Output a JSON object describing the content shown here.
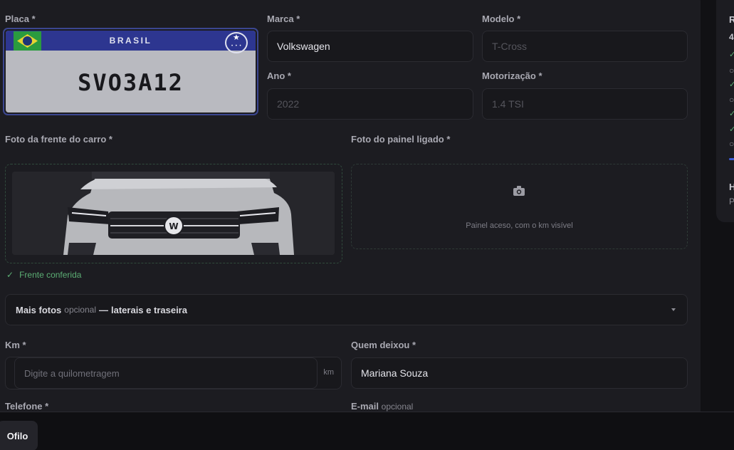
{
  "form": {
    "placa_label": "Placa *",
    "marca_label": "Marca *",
    "marca_value": "Volkswagen",
    "modelo_label": "Modelo *",
    "modelo_value": "T-Cross",
    "ano_label": "Ano *",
    "ano_value": "2022",
    "motor_label": "Motorização *",
    "motor_value": "1.4 TSI",
    "plate": {
      "country": "BRASIL",
      "number": "SVO3A12"
    },
    "foto_frente_label": "Foto da frente do carro *",
    "foto_painel_label": "Foto do painel ligado *",
    "painel_hint": "Painel aceso, com o km visível",
    "frente_status": "Frente conferida",
    "mais_fotos": {
      "title": "Mais fotos",
      "optional": "opcional",
      "separator": "—",
      "detail": "laterais e traseira"
    },
    "km_label": "Km *",
    "km_placeholder": "Digite a quilometragem",
    "km_unit": "km",
    "quem_label": "Quem deixou *",
    "quem_value": "Mariana Souza",
    "telefone_label": "Telefone *",
    "email_label": "E-mail",
    "email_optional": "opcional"
  },
  "side": {
    "title": "R",
    "count": "4",
    "heading2": "H",
    "sub2": "P"
  },
  "footer": {
    "brand": "Ofilo"
  },
  "colors": {
    "accent": "#3e5bd6",
    "success": "#5cae74",
    "card": "#1c1c21",
    "background": "#111114"
  }
}
